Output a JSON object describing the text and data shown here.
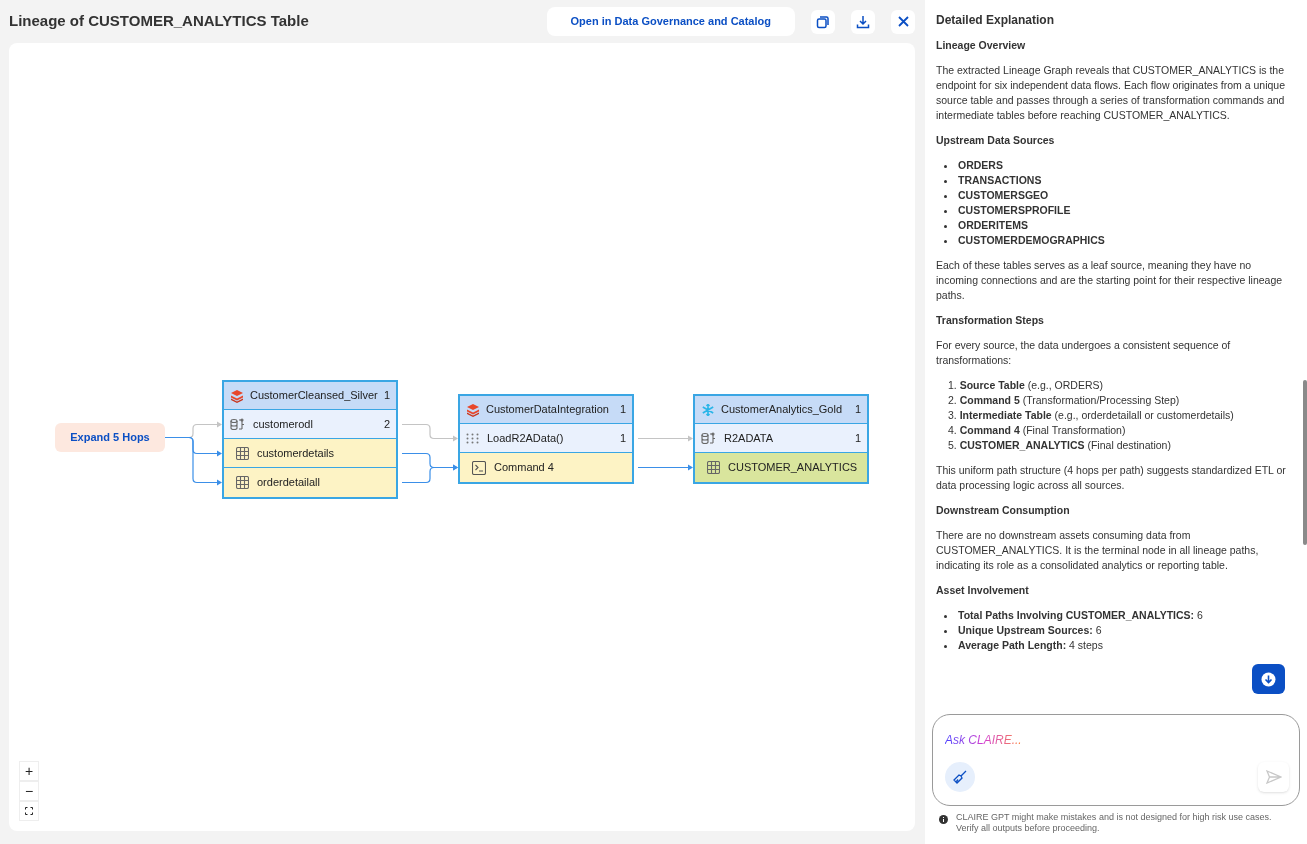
{
  "header": {
    "title": "Lineage of CUSTOMER_ANALYTICS Table",
    "open_button": "Open in Data Governance and Catalog"
  },
  "graph": {
    "expand_button": "Expand 5 Hops",
    "groups": [
      {
        "kind": "layers",
        "name": "CustomerCleansed_Silver",
        "count": "1",
        "rows": [
          {
            "kind": "database",
            "label": "customerodl",
            "count": "2",
            "highlighted": false
          },
          {
            "kind": "table",
            "label": "customerdetails",
            "highlighted": true
          },
          {
            "kind": "table",
            "label": "orderdetailall",
            "highlighted": true
          }
        ]
      },
      {
        "kind": "layers",
        "name": "CustomerDataIntegration",
        "count": "1",
        "rows": [
          {
            "kind": "grid",
            "label": "LoadR2AData()",
            "count": "1",
            "highlighted": false
          },
          {
            "kind": "terminal",
            "label": "Command 4",
            "highlighted": true
          }
        ]
      },
      {
        "kind": "snowflake",
        "name": "CustomerAnalytics_Gold",
        "count": "1",
        "rows": [
          {
            "kind": "database",
            "label": "R2ADATA",
            "count": "1",
            "highlighted": false
          },
          {
            "kind": "target",
            "label": "CUSTOMER_ANALYTICS",
            "highlighted": true
          }
        ]
      }
    ],
    "zoom_controls": [
      "+",
      "−"
    ]
  },
  "explanation": {
    "title": "Detailed Explanation",
    "blocks": [
      {
        "kind": "heading",
        "text": "Lineage Overview"
      },
      {
        "kind": "para",
        "text": "The extracted Lineage Graph reveals that CUSTOMER_ANALYTICS is the endpoint for six independent data flows. Each flow originates from a unique source table and passes through a series of transformation commands and intermediate tables before reaching CUSTOMER_ANALYTICS."
      },
      {
        "kind": "heading",
        "text": "Upstream Data Sources"
      },
      {
        "kind": "bullets",
        "items": [
          "**ORDERS**",
          "**TRANSACTIONS**",
          "**CUSTOMERSGEO**",
          "**CUSTOMERSPROFILE**",
          "**ORDERITEMS**",
          "**CUSTOMERDEMOGRAPHICS**"
        ]
      },
      {
        "kind": "para",
        "text": "Each of these tables serves as a leaf source, meaning they have no incoming connections and are the starting point for their respective lineage paths."
      },
      {
        "kind": "heading",
        "text": "Transformation Steps"
      },
      {
        "kind": "para",
        "text": "For every source, the data undergoes a consistent sequence of transformations:"
      },
      {
        "kind": "numbered",
        "items": [
          "1. **Source Table** (e.g., ORDERS)",
          "2. **Command 5** (Transformation/Processing Step)",
          "3. **Intermediate Table** (e.g., orderdetailall or customerdetails)",
          "4. **Command 4** (Final Transformation)",
          "5. **CUSTOMER_ANALYTICS** (Final destination)"
        ]
      },
      {
        "kind": "para",
        "text": "This uniform path structure (4 hops per path) suggests standardized ETL or data processing logic across all sources."
      },
      {
        "kind": "heading",
        "text": "Downstream Consumption"
      },
      {
        "kind": "para",
        "text": "There are no downstream assets consuming data from CUSTOMER_ANALYTICS. It is the terminal node in all lineage paths, indicating its role as a consolidated analytics or reporting table."
      },
      {
        "kind": "heading",
        "text": "Asset Involvement"
      },
      {
        "kind": "bullets",
        "items": [
          "**Total Paths Involving CUSTOMER_ANALYTICS:** 6",
          "**Unique Upstream Sources:** 6",
          "**Average Path Length:** 4 steps"
        ]
      }
    ]
  },
  "chat": {
    "placeholder": "Ask CLAIRE...",
    "disclaimer": "CLAIRE GPT might make mistakes and is not designed for high risk use cases. Verify all outputs before proceeding."
  }
}
